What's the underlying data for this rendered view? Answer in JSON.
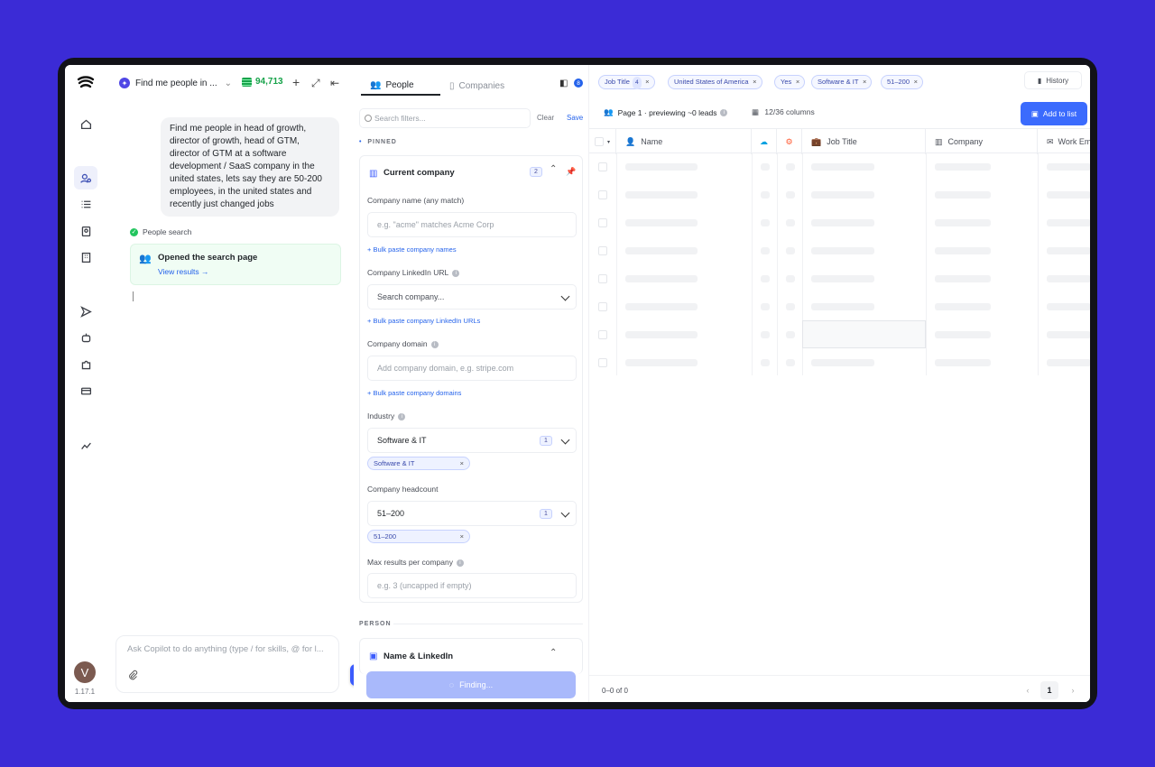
{
  "app": {
    "version": "1.17.1",
    "avatar_letter": "V",
    "accent": "#3b5bfd",
    "background": "#3b2bd6"
  },
  "chat": {
    "title": "Find me people in ...",
    "credits": "94,713",
    "user_message": "Find me people in head of growth, director of growth, head of GTM, director of GTM at a software development / SaaS company in the united states, lets say they are 50-200 employees, in the united states and recently just changed jobs",
    "tool_status": "People search",
    "tool_card_title": "Opened the search page",
    "tool_card_link": "View results →",
    "input_placeholder": "Ask Copilot to do anything (type / for skills, @ for l..."
  },
  "filters": {
    "tabs": [
      "People",
      "Companies"
    ],
    "layout_badge": "8",
    "search_placeholder": "Search filters...",
    "clear": "Clear",
    "save": "Save",
    "pinned_label": "PINNED",
    "person_label": "PERSON",
    "current_company": {
      "title": "Current company",
      "count": "2",
      "company_name_label": "Company name (any match)",
      "company_name_placeholder": "e.g. \"acme\" matches Acme Corp",
      "bulk_names": "+ Bulk paste company names",
      "linkedin_label": "Company LinkedIn URL",
      "linkedin_placeholder": "Search company...",
      "bulk_linkedin": "+ Bulk paste company LinkedIn URLs",
      "domain_label": "Company domain",
      "domain_placeholder": "Add company domain, e.g. stripe.com",
      "bulk_domains": "+ Bulk paste company domains",
      "industry_label": "Industry",
      "industry_value": "Software & IT",
      "industry_count": "1",
      "industry_chip": "Software & IT",
      "headcount_label": "Company headcount",
      "headcount_value": "51–200",
      "headcount_count": "1",
      "headcount_chip": "51–200",
      "max_label": "Max results per company",
      "max_placeholder": "e.g. 3 (uncapped if empty)"
    },
    "name_linkedin_title": "Name & LinkedIn",
    "finding": "Finding..."
  },
  "results": {
    "chips": [
      {
        "label": "Job Title",
        "count": "4"
      },
      {
        "label": "United States of America"
      },
      {
        "label": "Yes"
      },
      {
        "label": "Software & IT"
      },
      {
        "label": "51–200"
      }
    ],
    "history": "History",
    "page_info": "Page 1 · previewing ~0 leads",
    "columns_info": "12/36 columns",
    "add_to_list": "Add to list",
    "headers": {
      "name": "Name",
      "job_title": "Job Title",
      "company": "Company",
      "work_email": "Work Em"
    },
    "footer_count": "0–0 of 0",
    "current_page": "1"
  }
}
